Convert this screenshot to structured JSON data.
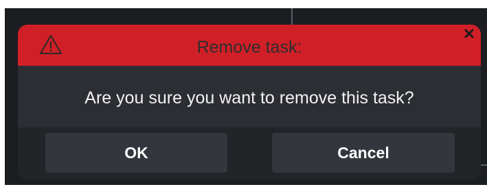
{
  "dialog": {
    "title": "Remove task:",
    "message": "Are you sure you want to remove this task?",
    "ok_label": "OK",
    "cancel_label": "Cancel",
    "icons": {
      "warning": "warning-triangle-icon",
      "close": "close-icon"
    }
  },
  "colors": {
    "title_bar": "#d11f27",
    "dialog_body": "#2c2e33",
    "footer": "#222428",
    "button": "#33363c"
  }
}
